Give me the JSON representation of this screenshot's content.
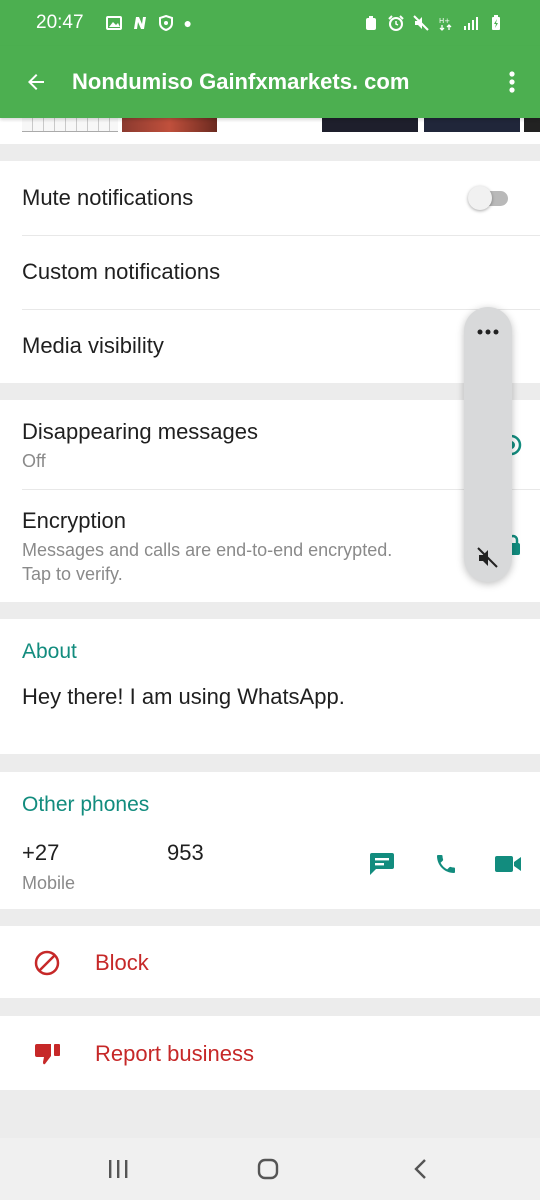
{
  "status_bar": {
    "time": "20:47"
  },
  "app_bar": {
    "title": "Nondumiso Gainfxmarkets. com"
  },
  "notifications": {
    "mute_label": "Mute notifications",
    "mute_enabled": false,
    "custom_label": "Custom notifications",
    "media_label": "Media visibility"
  },
  "privacy": {
    "disappearing_label": "Disappearing messages",
    "disappearing_value": "Off",
    "encryption_label": "Encryption",
    "encryption_sub_1": "Messages and calls are end-to-end encrypted.",
    "encryption_sub_2": "Tap to verify."
  },
  "about": {
    "label": "About",
    "text": "Hey there! I am using WhatsApp."
  },
  "other_phones": {
    "label": "Other phones",
    "number_prefix": "+27",
    "number_suffix": "953",
    "type": "Mobile"
  },
  "actions": {
    "block_label": "Block",
    "report_label": "Report business"
  },
  "colors": {
    "header": "#4caf50",
    "accent": "#128c7e",
    "danger": "#c62828"
  }
}
